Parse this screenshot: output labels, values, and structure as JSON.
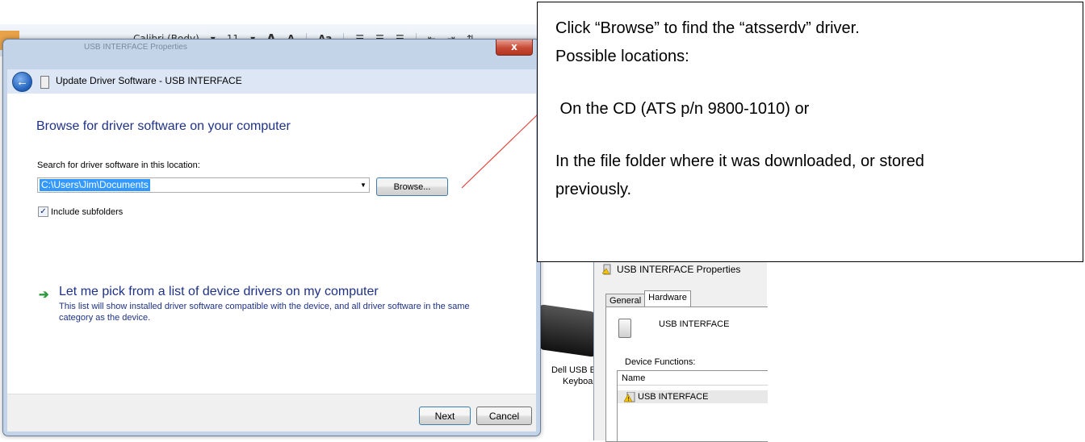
{
  "ribbon": {
    "font_name": "Calibri (Body)",
    "font_size": "11",
    "grow_font": "A",
    "shrink_font": "A",
    "change_case": "Aa"
  },
  "dialog": {
    "title": "Update Driver Software - USB INTERFACE",
    "ghost_title": "USB INTERFACE Properties",
    "close_label": "x",
    "heading": "Browse for driver software on your computer",
    "search_label": "Search for driver software in this location:",
    "path_value": "C:\\Users\\Jim\\Documents",
    "browse_label": "Browse...",
    "include_subfolders": "Include subfolders",
    "include_subfolders_checked": true,
    "pick_link": "Let me pick from a list of device drivers on my computer",
    "pick_description": "This list will show installed driver software compatible with the device, and all driver software in the same category as the device.",
    "next_label": "Next",
    "cancel_label": "Cancel"
  },
  "background": {
    "keyboard_label_line1": "Dell USB E",
    "keyboard_label_line2": "Keyboar"
  },
  "properties": {
    "title": "USB INTERFACE Properties",
    "tabs": [
      "General",
      "Hardware"
    ],
    "active_tab": "Hardware",
    "device_name": "USB INTERFACE",
    "device_functions_label": "Device Functions:",
    "list_header": "Name",
    "list_item": "USB INTERFACE"
  },
  "callout": {
    "line1": "Click “Browse” to find the “atsserdv” driver.",
    "line2": "Possible locations:",
    "line3": " On the CD (ATS p/n 9800-1010) or",
    "line4": "In the file folder where it was downloaded, or stored",
    "line5": "previously."
  },
  "colors": {
    "heading_blue": "#1e3287",
    "leader_line": "#e0322a",
    "selection": "#3399ff",
    "close_red": "#c74a35"
  }
}
